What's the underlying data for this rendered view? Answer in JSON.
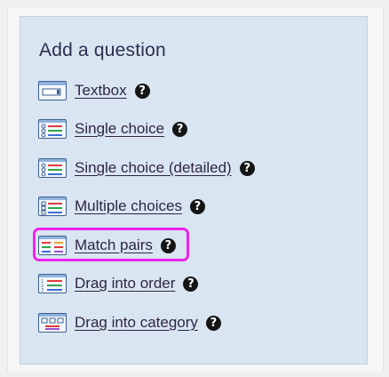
{
  "panel": {
    "title": "Add a question",
    "help_glyph": "?",
    "items": [
      {
        "label": "Textbox",
        "icon": "textbox-icon"
      },
      {
        "label": "Single choice",
        "icon": "single-choice-icon"
      },
      {
        "label": "Single choice (detailed)",
        "icon": "single-choice-detailed-icon"
      },
      {
        "label": "Multiple choices",
        "icon": "multiple-choices-icon"
      },
      {
        "label": "Match pairs",
        "icon": "match-pairs-icon"
      },
      {
        "label": "Drag into order",
        "icon": "drag-into-order-icon"
      },
      {
        "label": "Drag into category",
        "icon": "drag-into-category-icon"
      }
    ],
    "highlighted_item": "Match pairs"
  },
  "colors": {
    "panel_bg": "#d9e5f1",
    "highlight": "#ee22ee",
    "text": "#2e2545"
  }
}
